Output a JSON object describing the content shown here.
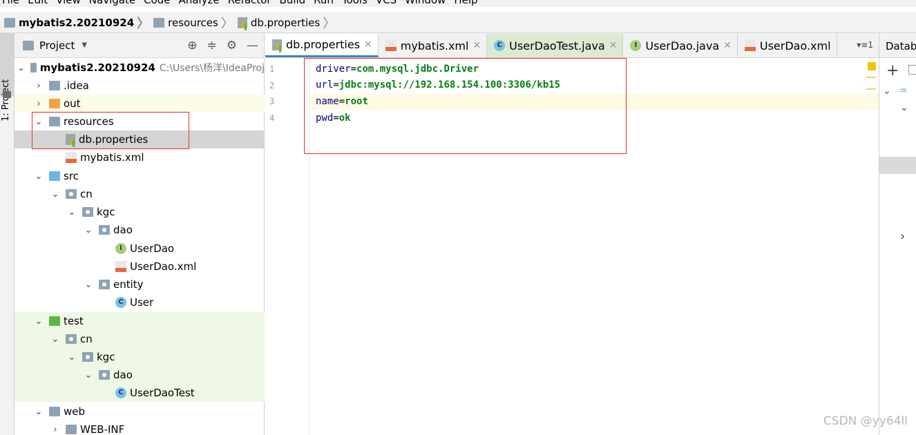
{
  "menu": [
    "File",
    "Edit",
    "View",
    "Navigate",
    "Code",
    "Analyze",
    "Refactor",
    "Build",
    "Run",
    "Tools",
    "VCS",
    "Window",
    "Help"
  ],
  "breadcrumb": [
    "mybatis2.20210924",
    "resources",
    "db.properties"
  ],
  "left_stripe": {
    "label": "1: Project"
  },
  "project_panel": {
    "title": "Project",
    "tree": [
      {
        "label": "mybatis2.20210924",
        "path": "C:\\Users\\杨洋\\IdeaProj",
        "icon": "folder-icon"
      },
      {
        "label": ".idea",
        "icon": "folder-icon"
      },
      {
        "label": "out",
        "icon": "folder-orange-icon"
      },
      {
        "label": "resources",
        "icon": "resources-folder-icon"
      },
      {
        "label": "db.properties",
        "icon": "properties-file-icon"
      },
      {
        "label": "mybatis.xml",
        "icon": "xml-file-icon"
      },
      {
        "label": "src",
        "icon": "source-folder-icon"
      },
      {
        "label": "cn",
        "icon": "package-icon"
      },
      {
        "label": "kgc",
        "icon": "package-icon"
      },
      {
        "label": "dao",
        "icon": "package-icon"
      },
      {
        "label": "UserDao",
        "icon": "interface-icon"
      },
      {
        "label": "UserDao.xml",
        "icon": "xml-file-icon"
      },
      {
        "label": "entity",
        "icon": "package-icon"
      },
      {
        "label": "User",
        "icon": "class-icon"
      },
      {
        "label": "test",
        "icon": "test-folder-icon"
      },
      {
        "label": "cn",
        "icon": "package-icon"
      },
      {
        "label": "kgc",
        "icon": "package-icon"
      },
      {
        "label": "dao",
        "icon": "package-icon"
      },
      {
        "label": "UserDaoTest",
        "icon": "test-class-icon"
      },
      {
        "label": "web",
        "icon": "web-folder-icon"
      },
      {
        "label": "WEB-INF",
        "icon": "folder-icon"
      }
    ]
  },
  "editor": {
    "tabs": [
      {
        "label": "db.properties",
        "icon": "properties-file-icon"
      },
      {
        "label": "mybatis.xml",
        "icon": "xml-file-icon"
      },
      {
        "label": "UserDaoTest.java",
        "icon": "test-class-icon"
      },
      {
        "label": "UserDao.java",
        "icon": "interface-icon"
      },
      {
        "label": "UserDao.xml",
        "icon": "xml-file-icon"
      }
    ],
    "tab_count": "1",
    "lines": [
      {
        "n": "1",
        "key": "driver",
        "value": "com.mysql.jdbc.Driver"
      },
      {
        "n": "2",
        "key": "url",
        "value": "jdbc:mysql://192.168.154.100:3306/kb15"
      },
      {
        "n": "3",
        "key": "name",
        "value": "root"
      },
      {
        "n": "4",
        "key": "pwd",
        "value": "ok"
      }
    ]
  },
  "right_panel": {
    "title": "Datab"
  },
  "watermark": "CSDN @yy64ll",
  "colors": {
    "highlight_box": "#e03030",
    "active_tab_underline": "#4083c9",
    "test_bg": "#eff8e6"
  }
}
